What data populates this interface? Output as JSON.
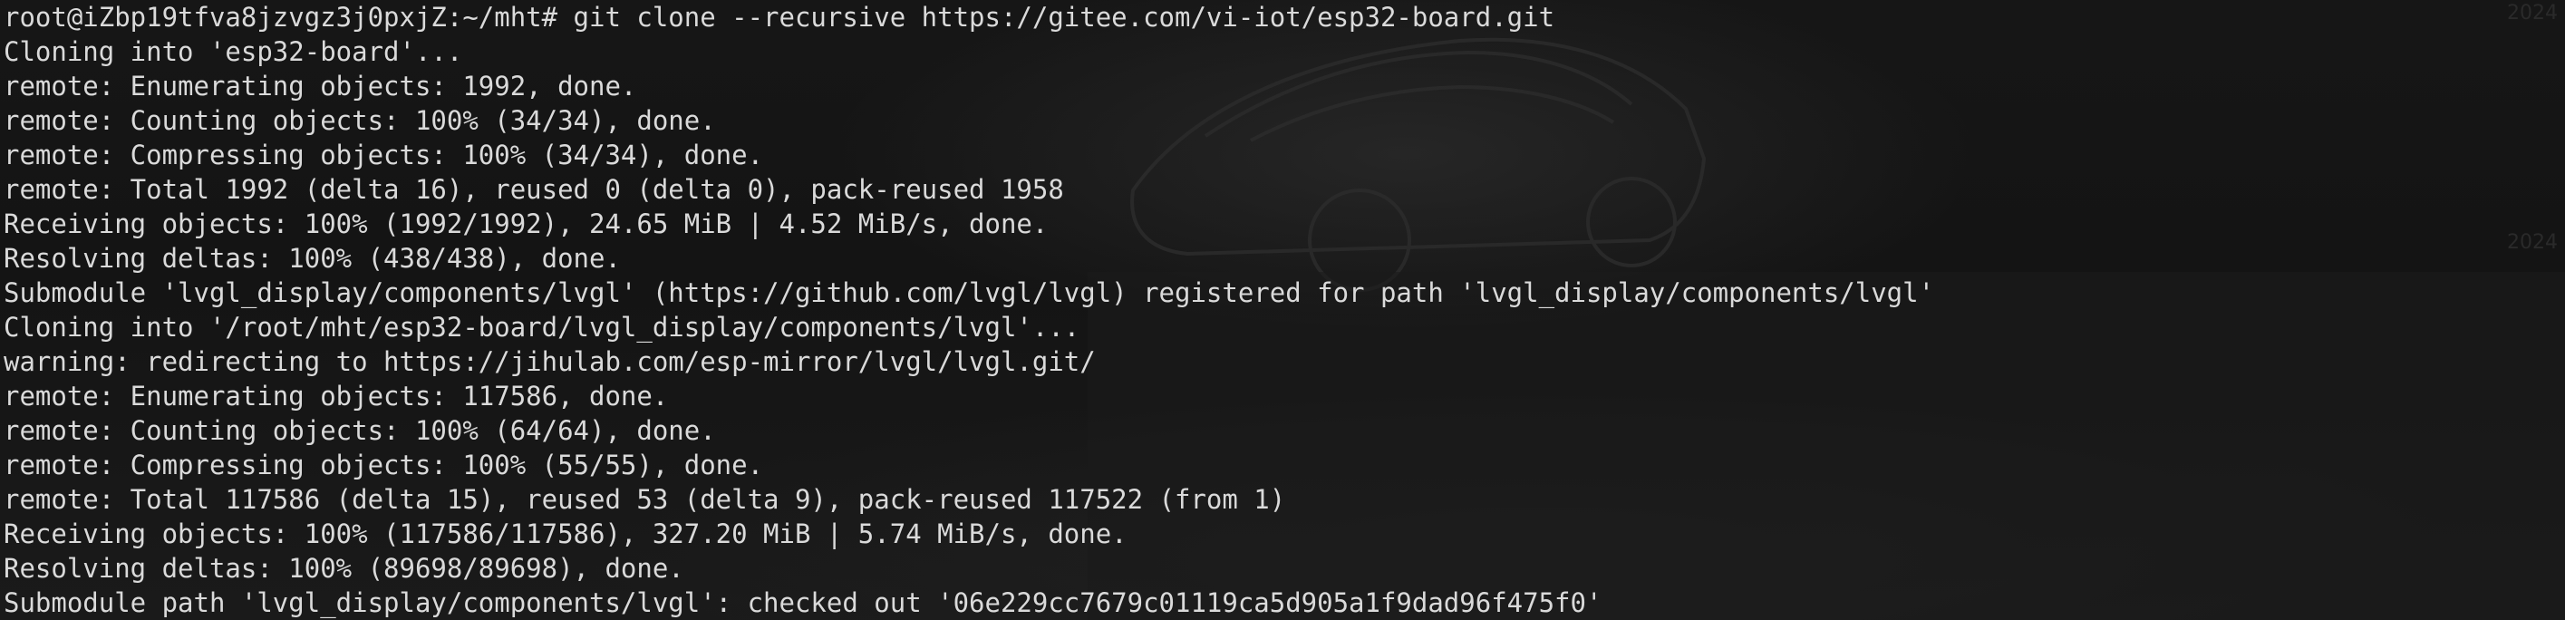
{
  "terminal": {
    "lines": [
      "root@iZbp19tfva8jzvgz3j0pxjZ:~/mht# git clone --recursive https://gitee.com/vi-iot/esp32-board.git",
      "Cloning into 'esp32-board'...",
      "remote: Enumerating objects: 1992, done.",
      "remote: Counting objects: 100% (34/34), done.",
      "remote: Compressing objects: 100% (34/34), done.",
      "remote: Total 1992 (delta 16), reused 0 (delta 0), pack-reused 1958",
      "Receiving objects: 100% (1992/1992), 24.65 MiB | 4.52 MiB/s, done.",
      "Resolving deltas: 100% (438/438), done.",
      "Submodule 'lvgl_display/components/lvgl' (https://github.com/lvgl/lvgl) registered for path 'lvgl_display/components/lvgl'",
      "Cloning into '/root/mht/esp32-board/lvgl_display/components/lvgl'...",
      "warning: redirecting to https://jihulab.com/esp-mirror/lvgl/lvgl.git/",
      "remote: Enumerating objects: 117586, done.",
      "remote: Counting objects: 100% (64/64), done.",
      "remote: Compressing objects: 100% (55/55), done.",
      "remote: Total 117586 (delta 15), reused 53 (delta 9), pack-reused 117522 (from 1)",
      "Receiving objects: 100% (117586/117586), 327.20 MiB | 5.74 MiB/s, done.",
      "Resolving deltas: 100% (89698/89698), done.",
      "Submodule path 'lvgl_display/components/lvgl': checked out '06e229cc7679c01119ca5d905a1f9dad96f475f0'"
    ]
  },
  "wallpaper": {
    "corner_top": "2024",
    "corner_mid": "2024"
  },
  "colors": {
    "background": "#151515",
    "text": "#dadada"
  }
}
